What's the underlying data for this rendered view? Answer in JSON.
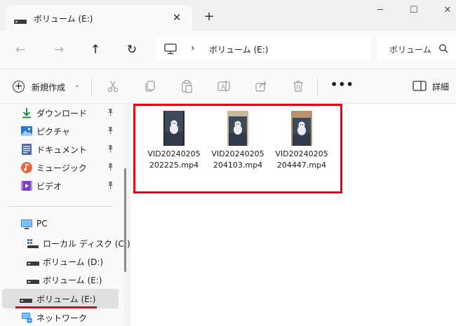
{
  "window": {
    "tab_title": "ボリューム (E:)",
    "tab_close": "✕",
    "new_tab": "+",
    "minimize": "─",
    "maximize": "☐",
    "close": "✕"
  },
  "nav": {
    "back": "←",
    "forward": "→",
    "up": "↑",
    "refresh": "↻",
    "separator": "›",
    "breadcrumb": "ボリューム (E:)",
    "search_placeholder": "ボリューム (E:)の検索"
  },
  "toolbar": {
    "new_label": "新規作成",
    "new_chevron": "⌄",
    "more": "•••",
    "details_label": "詳細"
  },
  "sidebar": {
    "quick_access": [
      {
        "label": "ダウンロード",
        "icon": "download-icon"
      },
      {
        "label": "ピクチャ",
        "icon": "pictures-icon"
      },
      {
        "label": "ドキュメント",
        "icon": "documents-icon"
      },
      {
        "label": "ミュージック",
        "icon": "music-icon"
      },
      {
        "label": "ビデオ",
        "icon": "videos-icon"
      }
    ],
    "pc_label": "PC",
    "drives": [
      {
        "label": "ローカル ディスク (C:)"
      },
      {
        "label": "ボリューム (D:)"
      },
      {
        "label": "ボリューム (E:)"
      }
    ],
    "selected_label": "ボリューム (E:)",
    "network_label": "ネットワーク"
  },
  "files": [
    {
      "name": "VID20240205202225.mp4"
    },
    {
      "name": "VID20240205204103.mp4"
    },
    {
      "name": "VID20240205204447.mp4"
    }
  ],
  "colors": {
    "accent_red": "#e60012",
    "selection": "#e0e0e0"
  }
}
